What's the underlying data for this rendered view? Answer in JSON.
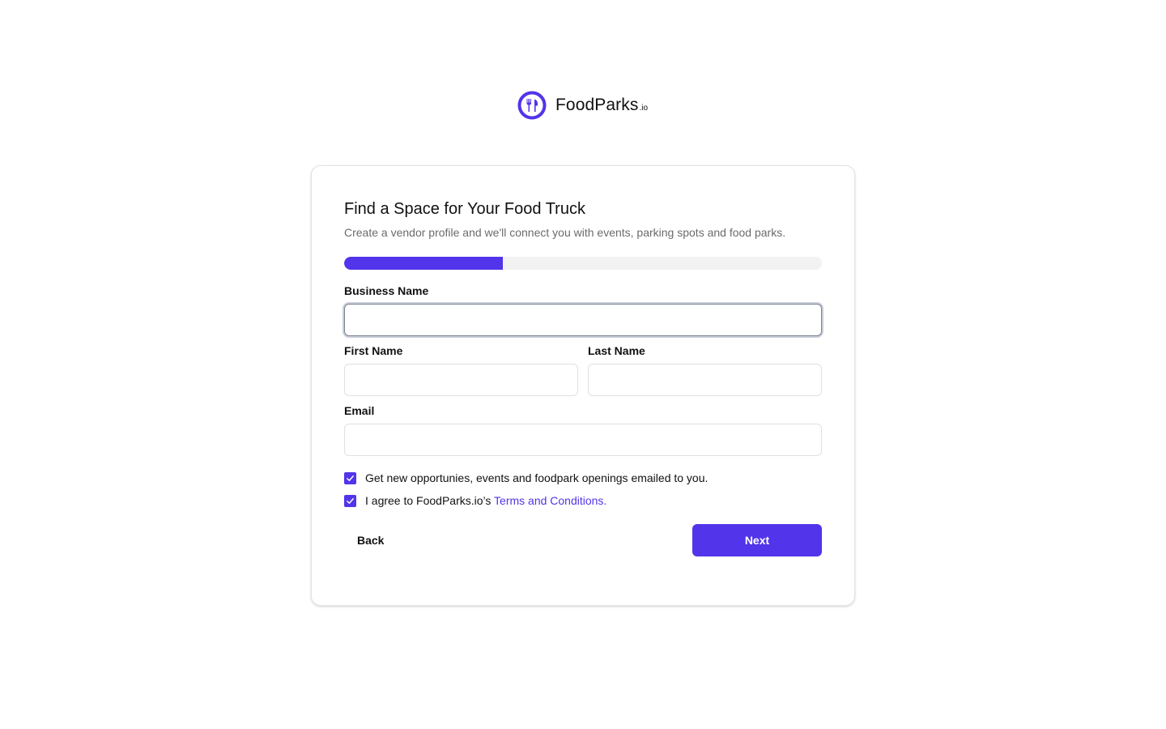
{
  "brand": {
    "name": "FoodParks",
    "suffix": ".io",
    "accent_color": "#5234ea",
    "icon": "fork-knife-icon"
  },
  "form": {
    "title": "Find a Space for Your Food Truck",
    "subtitle": "Create a vendor profile and we'll connect you with events, parking spots and food parks.",
    "progress_fraction": 0.333,
    "fields": {
      "business_name": {
        "label": "Business Name",
        "value": "",
        "placeholder": ""
      },
      "first_name": {
        "label": "First Name",
        "value": "",
        "placeholder": ""
      },
      "last_name": {
        "label": "Last Name",
        "value": "",
        "placeholder": ""
      },
      "email": {
        "label": "Email",
        "value": "",
        "placeholder": ""
      }
    },
    "checkboxes": {
      "opportunities": {
        "label": "Get new opportunies, events and foodpark openings emailed to you.",
        "checked": true
      },
      "terms": {
        "label": "I agree to FoodParks.io’s ",
        "link_text": "Terms and Conditions.",
        "checked": true
      }
    },
    "buttons": {
      "back": "Back",
      "next": "Next"
    }
  }
}
